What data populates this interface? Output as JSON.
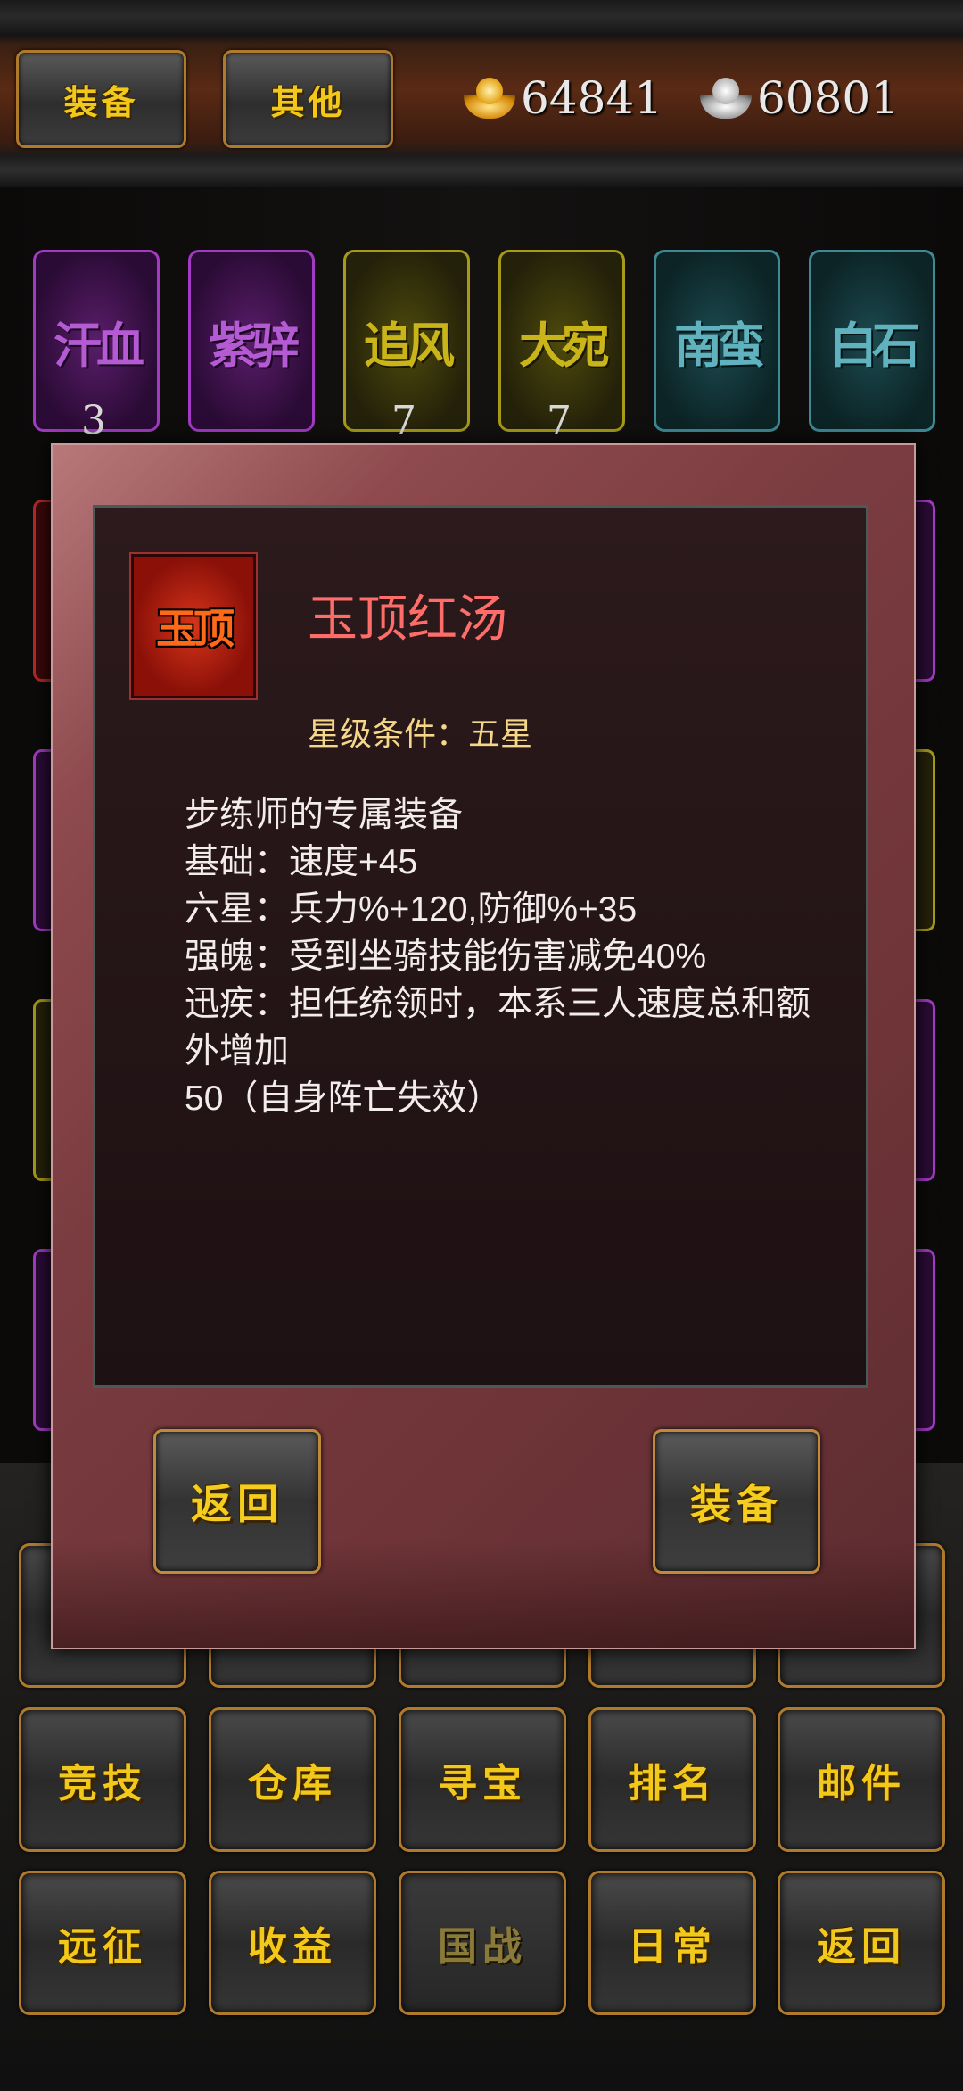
{
  "header": {
    "tabs": [
      {
        "label": "装备"
      },
      {
        "label": "其他"
      }
    ],
    "gold": "64841",
    "silver": "60801"
  },
  "horses": [
    {
      "name": "汗血",
      "count": "3",
      "color": "purple"
    },
    {
      "name": "紫骍",
      "count": "",
      "color": "purple"
    },
    {
      "name": "追风",
      "count": "7",
      "color": "yellow"
    },
    {
      "name": "大宛",
      "count": "7",
      "color": "yellow"
    },
    {
      "name": "南蛮",
      "count": "",
      "color": "cyan"
    },
    {
      "name": "白石",
      "count": "",
      "color": "cyan"
    }
  ],
  "modal": {
    "item_name": "玉顶红汤",
    "icon_text": "玉顶",
    "star_condition": "星级条件：五星",
    "description": [
      "步练师的专属装备",
      "基础：速度+45",
      "六星：兵力%+120,防御%+35",
      "强魄：受到坐骑技能伤害减免40%",
      "迅疾：担任统领时，本系三人速度总和额外增加",
      "50（自身阵亡失效）"
    ],
    "back_label": "返回",
    "equip_label": "装备"
  },
  "menu": {
    "row2": [
      "竞技",
      "仓库",
      "寻宝",
      "排名",
      "邮件"
    ],
    "row3": [
      "远征",
      "收益",
      "国战",
      "日常",
      "返回"
    ]
  },
  "colors": {
    "accent_gold": "#f2c81a",
    "item_name": "#ff6d6a",
    "star_condition": "#f5d78a"
  }
}
